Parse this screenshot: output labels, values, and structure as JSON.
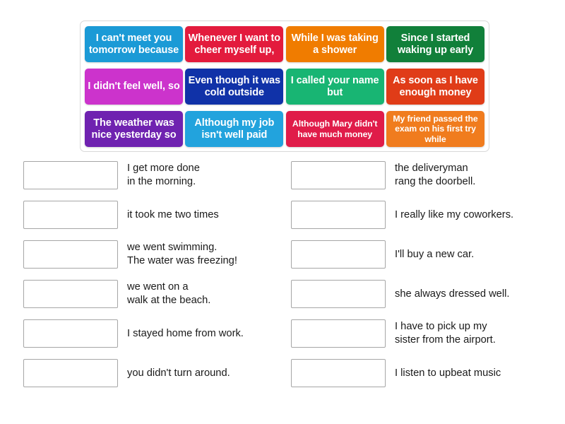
{
  "activity": {
    "type": "match-up-drag-and-drop"
  },
  "tile_bank": {
    "rows": [
      [
        {
          "label": "I can't meet you tomorrow because",
          "color": "#1b9ad6",
          "lines": 2
        },
        {
          "label": "Whenever I want to cheer myself up,",
          "color": "#e31b3d",
          "lines": 2
        },
        {
          "label": "While I was taking a shower",
          "color": "#f07c00",
          "lines": 2
        },
        {
          "label": "Since I started waking up early",
          "color": "#11803a",
          "lines": 2
        }
      ],
      [
        {
          "label": "I didn't feel well, so",
          "color": "#cc33cc",
          "lines": 2
        },
        {
          "label": "Even though it was cold outside",
          "color": "#1032a8",
          "lines": 2
        },
        {
          "label": "I called your name but",
          "color": "#18b573",
          "lines": 2
        },
        {
          "label": "As soon as I have enough money",
          "color": "#e03c18",
          "lines": 2
        }
      ],
      [
        {
          "label": "The weather was nice yesterday so",
          "color": "#6f22b0",
          "lines": 2
        },
        {
          "label": "Although my job isn't well paid",
          "color": "#22a3dd",
          "lines": 2
        },
        {
          "label": "Although Mary didn't have much money",
          "color": "#e01c49",
          "lines": 3
        },
        {
          "label": "My friend passed the exam on his first try while",
          "color": "#f07c1e",
          "lines": 3
        }
      ]
    ]
  },
  "left_column": {
    "rows": [
      {
        "answer": "",
        "text": "I get more done\nin the morning."
      },
      {
        "answer": "",
        "text": "it took me two times"
      },
      {
        "answer": "",
        "text": "we went swimming.\nThe water was freezing!"
      },
      {
        "answer": "",
        "text": "we went on a\nwalk at the beach."
      },
      {
        "answer": "",
        "text": "I stayed home from work."
      },
      {
        "answer": "",
        "text": "you didn't turn around."
      }
    ]
  },
  "right_column": {
    "rows": [
      {
        "answer": "",
        "text": "the deliveryman\nrang the doorbell."
      },
      {
        "answer": "",
        "text": "I really like my coworkers."
      },
      {
        "answer": "",
        "text": "I'll buy a new car."
      },
      {
        "answer": "",
        "text": "she always dressed well."
      },
      {
        "answer": "",
        "text": "I have to pick up my\nsister from the airport."
      },
      {
        "answer": "",
        "text": "I listen to upbeat music"
      }
    ]
  }
}
